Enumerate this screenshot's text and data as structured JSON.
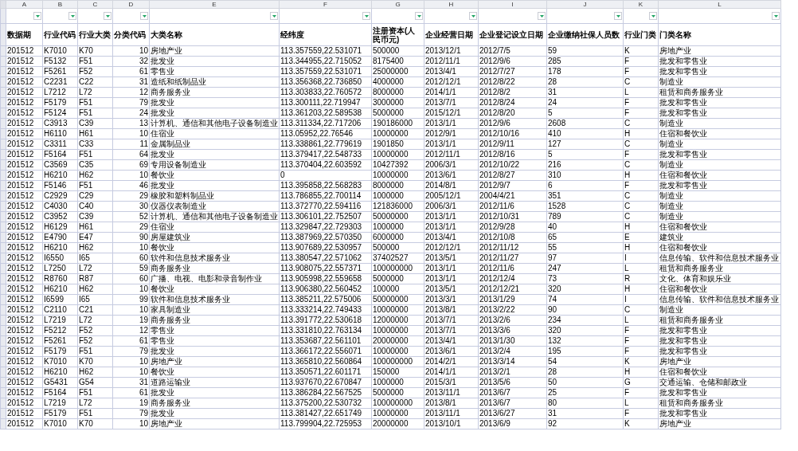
{
  "columns": [
    {
      "letter": "A",
      "header": "数据期",
      "numeric": false,
      "filter": true
    },
    {
      "letter": "B",
      "header": "行业代码",
      "numeric": false,
      "filter": true
    },
    {
      "letter": "C",
      "header": "行业大类",
      "numeric": false,
      "filter": true
    },
    {
      "letter": "D",
      "header": "分类代码",
      "numeric": true,
      "filter": true
    },
    {
      "letter": "E",
      "header": "大类名称",
      "numeric": false,
      "filter": true
    },
    {
      "letter": "F",
      "header": "经纬度",
      "numeric": false,
      "filter": true
    },
    {
      "letter": "G",
      "header": "注册资本(人民币元)",
      "numeric": false,
      "filter": true
    },
    {
      "letter": "H",
      "header": "企业经营日期",
      "numeric": false,
      "filter": true
    },
    {
      "letter": "I",
      "header": "企业登记设立日期",
      "numeric": false,
      "filter": true
    },
    {
      "letter": "J",
      "header": "企业缴纳社保人员数",
      "numeric": false,
      "filter": true
    },
    {
      "letter": "K",
      "header": "行业门类",
      "numeric": false,
      "filter": true
    },
    {
      "letter": "L",
      "header": "门类名称",
      "numeric": false,
      "filter": true
    }
  ],
  "rows": [
    [
      "201512",
      "K7010",
      "K70",
      "10",
      "房地产业",
      "113.357559,22.531071",
      "500000",
      "2013/12/1",
      "2012/7/5",
      "59",
      "K",
      "房地产业"
    ],
    [
      "201512",
      "F5132",
      "F51",
      "32",
      "批发业",
      "113.344955,22.715052",
      "8175400",
      "2012/11/1",
      "2012/9/6",
      "285",
      "F",
      "批发和零售业"
    ],
    [
      "201512",
      "F5261",
      "F52",
      "61",
      "零售业",
      "113.357559,22.531071",
      "25000000",
      "2013/4/1",
      "2012/7/27",
      "178",
      "F",
      "批发和零售业"
    ],
    [
      "201512",
      "C2231",
      "C22",
      "31",
      "造纸和纸制品业",
      "113.356368,22.736850",
      "4000000",
      "2012/12/1",
      "2012/8/22",
      "28",
      "C",
      "制造业"
    ],
    [
      "201512",
      "L7212",
      "L72",
      "12",
      "商务服务业",
      "113.303833,22.760572",
      "8000000",
      "2014/1/1",
      "2012/8/2",
      "31",
      "L",
      "租赁和商务服务业"
    ],
    [
      "201512",
      "F5179",
      "F51",
      "79",
      "批发业",
      "113.300111,22.719947",
      "3000000",
      "2013/7/1",
      "2012/8/24",
      "24",
      "F",
      "批发和零售业"
    ],
    [
      "201512",
      "F5124",
      "F51",
      "24",
      "批发业",
      "113.361203,22.589538",
      "5000000",
      "2015/12/1",
      "2012/8/20",
      "5",
      "F",
      "批发和零售业"
    ],
    [
      "201512",
      "C3913",
      "C39",
      "13",
      "计算机、通信和其他电子设备制造业",
      "113.311334,22.717206",
      "190186000",
      "2013/1/1",
      "2012/9/6",
      "2608",
      "C",
      "制造业"
    ],
    [
      "201512",
      "H6110",
      "H61",
      "10",
      "住宿业",
      "113.05952,22.76546",
      "10000000",
      "2012/9/1",
      "2012/10/16",
      "410",
      "H",
      "住宿和餐饮业"
    ],
    [
      "201512",
      "C3311",
      "C33",
      "11",
      "金属制品业",
      "113.338861,22.779619",
      "1901850",
      "2013/1/1",
      "2012/9/11",
      "127",
      "C",
      "制造业"
    ],
    [
      "201512",
      "F5164",
      "F51",
      "64",
      "批发业",
      "113.379417,22.548733",
      "10000000",
      "2012/11/1",
      "2012/8/16",
      "5",
      "F",
      "批发和零售业"
    ],
    [
      "201512",
      "C3569",
      "C35",
      "69",
      "专用设备制造业",
      "113.370404,22.603592",
      "10427392",
      "2006/3/1",
      "2012/10/22",
      "216",
      "C",
      "制造业"
    ],
    [
      "201512",
      "H6210",
      "H62",
      "10",
      "餐饮业",
      "0",
      "10000000",
      "2013/6/1",
      "2012/8/27",
      "310",
      "H",
      "住宿和餐饮业"
    ],
    [
      "201512",
      "F5146",
      "F51",
      "46",
      "批发业",
      "113.395858,22.568283",
      "8000000",
      "2014/8/1",
      "2012/9/7",
      "6",
      "F",
      "批发和零售业"
    ],
    [
      "201512",
      "C2929",
      "C29",
      "29",
      "橡胶和塑料制品业",
      "113.786855,22.700114",
      "1000000",
      "2005/12/1",
      "2004/4/21",
      "351",
      "C",
      "制造业"
    ],
    [
      "201512",
      "C4030",
      "C40",
      "30",
      "仪器仪表制造业",
      "113.372770,22.594116",
      "121836000",
      "2006/3/1",
      "2012/11/6",
      "1528",
      "C",
      "制造业"
    ],
    [
      "201512",
      "C3952",
      "C39",
      "52",
      "计算机、通信和其他电子设备制造业",
      "113.306101,22.752507",
      "50000000",
      "2013/1/1",
      "2012/10/31",
      "789",
      "C",
      "制造业"
    ],
    [
      "201512",
      "H6129",
      "H61",
      "29",
      "住宿业",
      "113.329847,22.729303",
      "1000000",
      "2013/1/1",
      "2012/9/28",
      "40",
      "H",
      "住宿和餐饮业"
    ],
    [
      "201512",
      "E4790",
      "E47",
      "90",
      "房屋建筑业",
      "113.387969,22.570350",
      "6000000",
      "2013/4/1",
      "2012/10/8",
      "65",
      "E",
      "建筑业"
    ],
    [
      "201512",
      "H6210",
      "H62",
      "10",
      "餐饮业",
      "113.907689,22.530957",
      "500000",
      "2012/12/1",
      "2012/11/12",
      "55",
      "H",
      "住宿和餐饮业"
    ],
    [
      "201512",
      "I6550",
      "I65",
      "60",
      "软件和信息技术服务业",
      "113.380547,22.571062",
      "37402527",
      "2013/5/1",
      "2012/11/27",
      "97",
      "I",
      "信息传输、软件和信息技术服务业"
    ],
    [
      "201512",
      "L7250",
      "L72",
      "59",
      "商务服务业",
      "113.908075,22.557371",
      "100000000",
      "2013/1/1",
      "2012/11/6",
      "247",
      "L",
      "租赁和商务服务业"
    ],
    [
      "201512",
      "R8760",
      "R87",
      "60",
      "广播、电视、电影和录音制作业",
      "113.905998,22.559658",
      "5000000",
      "2013/1/1",
      "2012/12/4",
      "73",
      "R",
      "文化、体育和娱乐业"
    ],
    [
      "201512",
      "H6210",
      "H62",
      "10",
      "餐饮业",
      "113.906380,22.560452",
      "100000",
      "2013/5/1",
      "2012/12/21",
      "320",
      "H",
      "住宿和餐饮业"
    ],
    [
      "201512",
      "I6599",
      "I65",
      "99",
      "软件和信息技术服务业",
      "113.385211,22.575006",
      "50000000",
      "2013/3/1",
      "2013/1/29",
      "74",
      "I",
      "信息传输、软件和信息技术服务业"
    ],
    [
      "201512",
      "C2110",
      "C21",
      "10",
      "家具制造业",
      "113.333214,22.749433",
      "10000000",
      "2013/8/1",
      "2013/2/22",
      "90",
      "C",
      "制造业"
    ],
    [
      "201512",
      "L7219",
      "L72",
      "19",
      "商务服务业",
      "113.391772,22.530618",
      "12000000",
      "2013/7/1",
      "2013/2/6",
      "234",
      "L",
      "租赁和商务服务业"
    ],
    [
      "201512",
      "F5212",
      "F52",
      "12",
      "零售业",
      "113.331810,22.763134",
      "10000000",
      "2013/7/1",
      "2013/3/6",
      "320",
      "F",
      "批发和零售业"
    ],
    [
      "201512",
      "F5261",
      "F52",
      "61",
      "零售业",
      "113.353687,22.561101",
      "20000000",
      "2013/4/1",
      "2013/1/30",
      "132",
      "F",
      "批发和零售业"
    ],
    [
      "201512",
      "F5179",
      "F51",
      "79",
      "批发业",
      "113.366172,22.556071",
      "10000000",
      "2013/6/1",
      "2013/2/4",
      "195",
      "F",
      "批发和零售业"
    ],
    [
      "201512",
      "K7010",
      "K70",
      "10",
      "房地产业",
      "113.365810,22.560864",
      "100000000",
      "2014/2/1",
      "2013/3/14",
      "54",
      "K",
      "房地产业"
    ],
    [
      "201512",
      "H6210",
      "H62",
      "10",
      "餐饮业",
      "113.350571,22.601171",
      "150000",
      "2014/1/1",
      "2013/2/1",
      "28",
      "H",
      "住宿和餐饮业"
    ],
    [
      "201512",
      "G5431",
      "G54",
      "31",
      "道路运输业",
      "113.937670,22.670847",
      "1000000",
      "2015/3/1",
      "2013/5/6",
      "50",
      "G",
      "交通运输、仓储和邮政业"
    ],
    [
      "201512",
      "F5164",
      "F51",
      "61",
      "批发业",
      "113.386284,22.567525",
      "5000000",
      "2013/11/1",
      "2013/6/7",
      "25",
      "F",
      "批发和零售业"
    ],
    [
      "201512",
      "L7219",
      "L72",
      "19",
      "商务服务业",
      "113.375200,22.530732",
      "100000000",
      "2013/8/1",
      "2013/6/7",
      "80",
      "L",
      "租赁和商务服务业"
    ],
    [
      "201512",
      "F5179",
      "F51",
      "79",
      "批发业",
      "113.381427,22.651749",
      "10000000",
      "2013/11/1",
      "2013/6/27",
      "31",
      "F",
      "批发和零售业"
    ],
    [
      "201512",
      "K7010",
      "K70",
      "10",
      "房地产业",
      "113.799904,22.725953",
      "20000000",
      "2013/10/1",
      "2013/6/9",
      "92",
      "K",
      "房地产业"
    ]
  ]
}
